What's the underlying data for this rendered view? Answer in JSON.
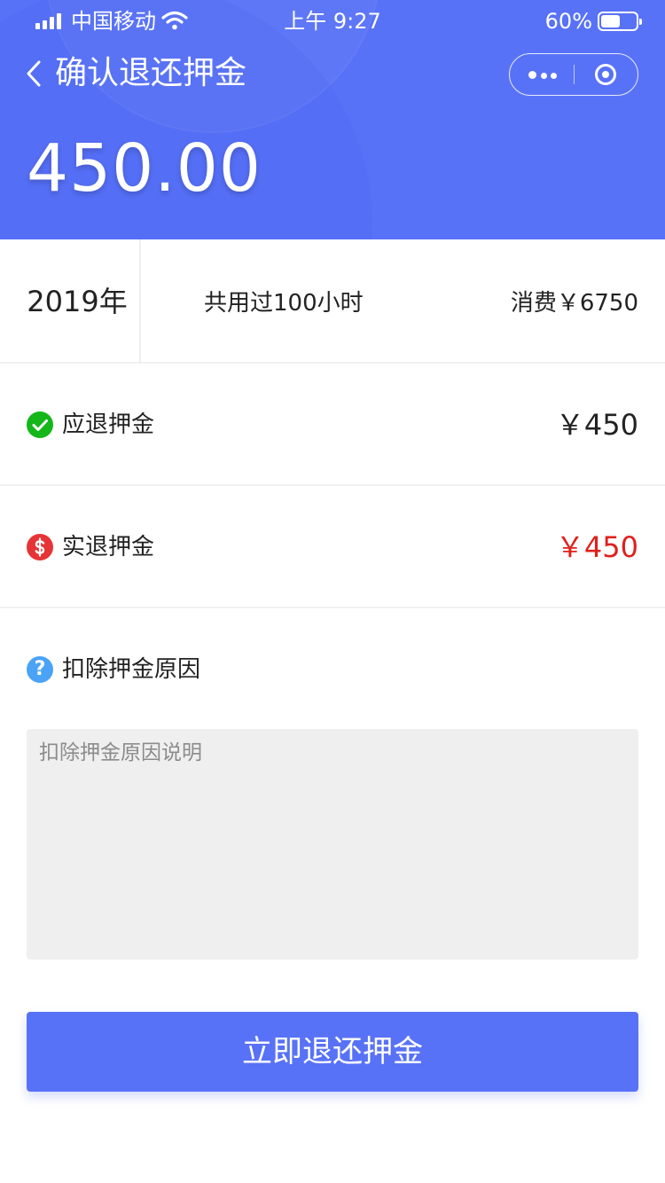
{
  "status_bar": {
    "carrier": "中国移动",
    "time": "上午 9:27",
    "battery_pct": "60%",
    "battery_level": 0.6
  },
  "nav": {
    "title": "确认退还押金"
  },
  "header": {
    "amount": "450.00"
  },
  "summary": {
    "year": "2019年",
    "hours": "共用过100小时",
    "cost": "消费￥6750"
  },
  "rows": [
    {
      "icon": "check-circle-icon",
      "label": "应退押金",
      "value": "￥450",
      "value_color": "#222222"
    },
    {
      "icon": "dollar-circle-icon",
      "label": "实退押金",
      "value": "￥450",
      "value_color": "#E0201B"
    }
  ],
  "reason": {
    "icon": "question-circle-icon",
    "label": "扣除押金原因",
    "placeholder": "扣除押金原因说明",
    "value": ""
  },
  "submit_label": "立即退还押金",
  "colors": {
    "primary": "#5872F7",
    "success": "#14B71A",
    "danger": "#E63436",
    "info": "#4BA3F7"
  }
}
